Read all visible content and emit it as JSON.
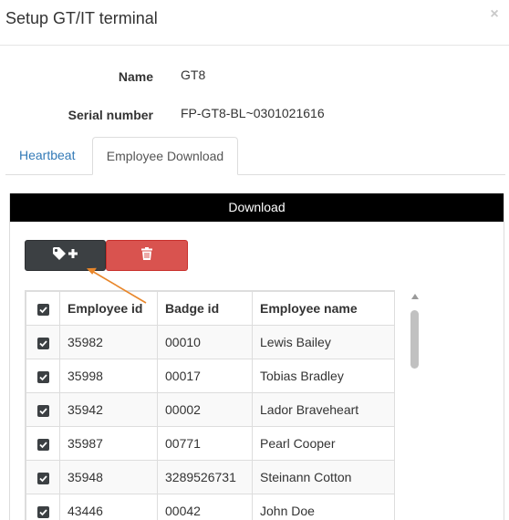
{
  "modal": {
    "title": "Setup GT/IT terminal",
    "close_symbol": "×"
  },
  "fields": {
    "name_label": "Name",
    "name_value": "GT8",
    "serial_label": "Serial number",
    "serial_value": "FP-GT8-BL~0301021616"
  },
  "tabs": [
    {
      "label": "Heartbeat",
      "active": false
    },
    {
      "label": "Employee Download",
      "active": true
    }
  ],
  "panel": {
    "heading": "Download",
    "buttons": {
      "tag_add_icon": "tag-plus-icon",
      "delete_icon": "trash-icon"
    }
  },
  "table": {
    "headers": [
      "Employee id",
      "Badge id",
      "Employee name"
    ],
    "rows": [
      {
        "checked": true,
        "employee_id": "35982",
        "badge_id": "00010",
        "name": "Lewis Bailey"
      },
      {
        "checked": true,
        "employee_id": "35998",
        "badge_id": "00017",
        "name": "Tobias Bradley"
      },
      {
        "checked": true,
        "employee_id": "35942",
        "badge_id": "00002",
        "name": "Lador Braveheart"
      },
      {
        "checked": true,
        "employee_id": "35987",
        "badge_id": "00771",
        "name": "Pearl Cooper"
      },
      {
        "checked": true,
        "employee_id": "35948",
        "badge_id": "3289526731",
        "name": "Steinann Cotton"
      },
      {
        "checked": true,
        "employee_id": "43446",
        "badge_id": "00042",
        "name": "John Doe"
      }
    ]
  },
  "colors": {
    "accent_link": "#337ab7",
    "dark_button": "#3c4043",
    "danger_button": "#d9534f",
    "annotation_arrow": "#e8862a"
  }
}
